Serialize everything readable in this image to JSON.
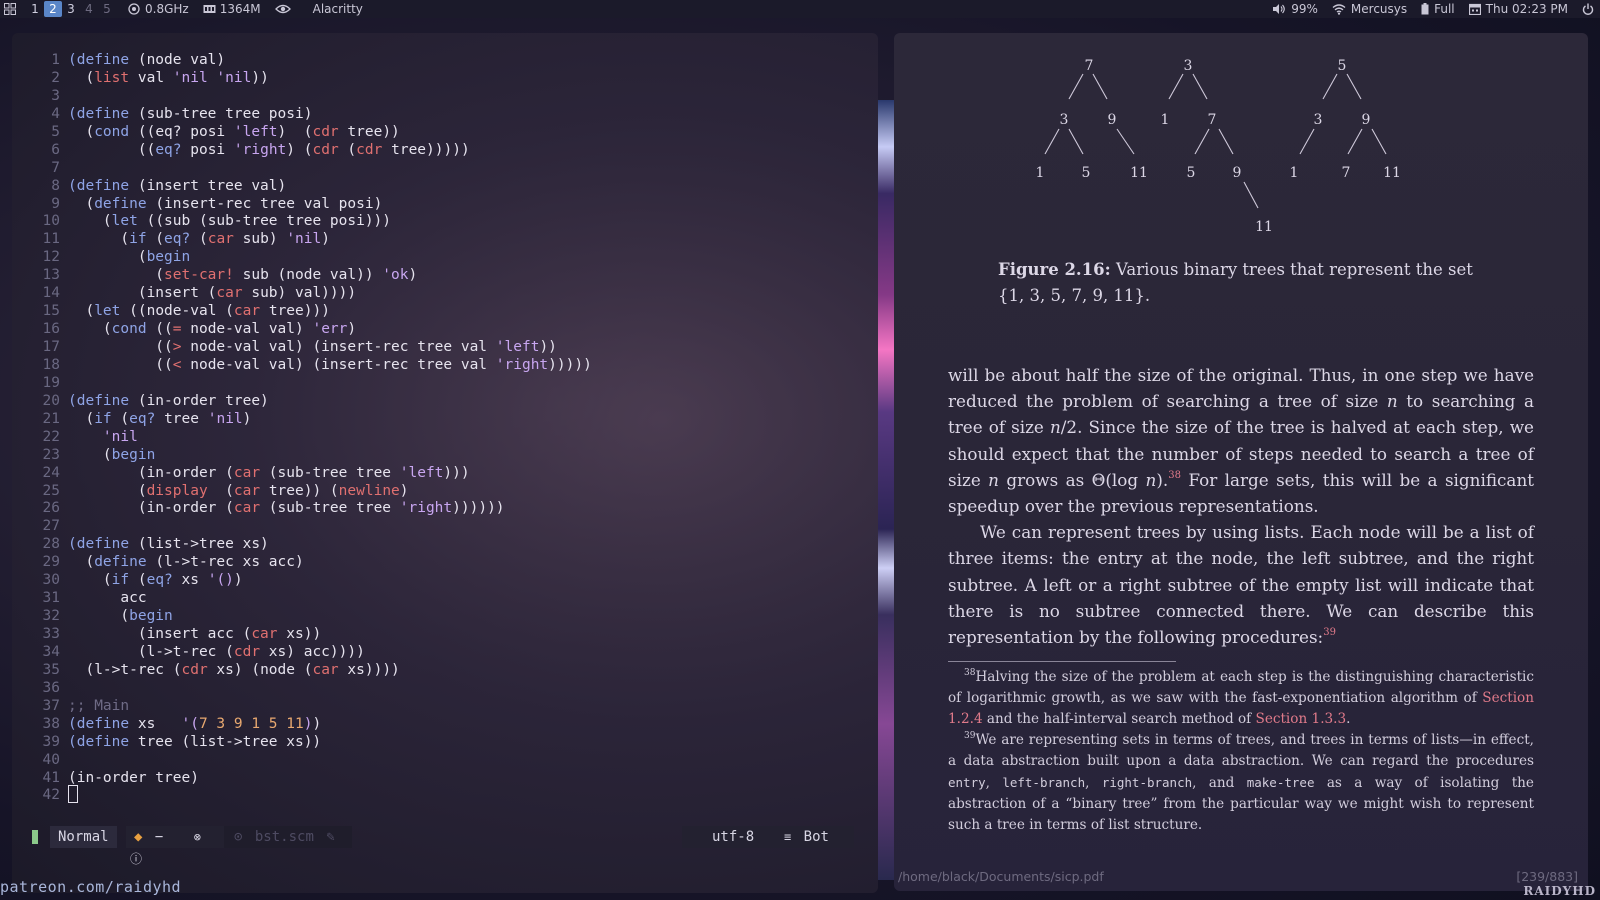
{
  "topbar": {
    "workspaces": [
      "1",
      "2",
      "3",
      "4",
      "5"
    ],
    "active_workspace": "2",
    "cpu": "0.8GHz",
    "memory": "1364M",
    "window_title": "Alacritty",
    "volume": "99%",
    "wifi": "Mercusys",
    "battery": "Full",
    "clock": "Thu 02:23 PM"
  },
  "editor": {
    "lines": [
      {
        "n": "1",
        "t": [
          [
            "kw",
            "(define"
          ],
          [
            "p",
            " (node val)"
          ]
        ]
      },
      {
        "n": "2",
        "t": [
          [
            "p",
            "  ("
          ],
          [
            "fn",
            "list"
          ],
          [
            "p",
            " val "
          ],
          [
            "sym",
            "'nil 'nil"
          ],
          [
            "p",
            "))"
          ]
        ]
      },
      {
        "n": "3",
        "t": []
      },
      {
        "n": "4",
        "t": [
          [
            "kw",
            "(define"
          ],
          [
            "p",
            " (sub-tree tree posi)"
          ]
        ]
      },
      {
        "n": "5",
        "t": [
          [
            "p",
            "  ("
          ],
          [
            "kw",
            "cond"
          ],
          [
            "p",
            " ((eq? posi "
          ],
          [
            "sym",
            "'left"
          ],
          [
            "p",
            ")  ("
          ],
          [
            "fn",
            "cdr"
          ],
          [
            "p",
            " tree))"
          ]
        ]
      },
      {
        "n": "6",
        "t": [
          [
            "p",
            "        (("
          ],
          [
            "kw",
            "eq?"
          ],
          [
            "p",
            " posi "
          ],
          [
            "sym",
            "'right"
          ],
          [
            "p",
            ") ("
          ],
          [
            "fn",
            "cdr"
          ],
          [
            "p",
            " ("
          ],
          [
            "fn",
            "cdr"
          ],
          [
            "p",
            " tree)))))"
          ]
        ]
      },
      {
        "n": "7",
        "t": []
      },
      {
        "n": "8",
        "t": [
          [
            "kw",
            "(define"
          ],
          [
            "p",
            " (insert tree val)"
          ]
        ]
      },
      {
        "n": "9",
        "t": [
          [
            "p",
            "  ("
          ],
          [
            "kw",
            "define"
          ],
          [
            "p",
            " (insert-rec tree val posi)"
          ]
        ]
      },
      {
        "n": "10",
        "t": [
          [
            "p",
            "    ("
          ],
          [
            "kw",
            "let"
          ],
          [
            "p",
            " ((sub (sub-tree tree posi)))"
          ]
        ]
      },
      {
        "n": "11",
        "t": [
          [
            "p",
            "      ("
          ],
          [
            "kw",
            "if"
          ],
          [
            "p",
            " ("
          ],
          [
            "kw",
            "eq?"
          ],
          [
            "p",
            " ("
          ],
          [
            "fn",
            "car"
          ],
          [
            "p",
            " sub) "
          ],
          [
            "sym",
            "'nil"
          ],
          [
            "p",
            ")"
          ]
        ]
      },
      {
        "n": "12",
        "t": [
          [
            "p",
            "        ("
          ],
          [
            "kw",
            "begin"
          ]
        ]
      },
      {
        "n": "13",
        "t": [
          [
            "p",
            "          ("
          ],
          [
            "fn",
            "set-car!"
          ],
          [
            "p",
            " sub (node val)) "
          ],
          [
            "sym",
            "'ok"
          ],
          [
            "p",
            ")"
          ]
        ]
      },
      {
        "n": "14",
        "t": [
          [
            "p",
            "        (insert ("
          ],
          [
            "fn",
            "car"
          ],
          [
            "p",
            " sub) val))))"
          ]
        ]
      },
      {
        "n": "15",
        "t": [
          [
            "p",
            "  ("
          ],
          [
            "kw",
            "let"
          ],
          [
            "p",
            " ((node-val ("
          ],
          [
            "fn",
            "car"
          ],
          [
            "p",
            " tree)))"
          ]
        ]
      },
      {
        "n": "16",
        "t": [
          [
            "p",
            "    ("
          ],
          [
            "kw",
            "cond"
          ],
          [
            "p",
            " (("
          ],
          [
            "fn",
            "="
          ],
          [
            "p",
            " node-val val) "
          ],
          [
            "sym",
            "'err"
          ],
          [
            "p",
            ")"
          ]
        ]
      },
      {
        "n": "17",
        "t": [
          [
            "p",
            "          (("
          ],
          [
            "fn",
            ">"
          ],
          [
            "p",
            " node-val val) (insert-rec tree val "
          ],
          [
            "sym",
            "'left"
          ],
          [
            "p",
            "))"
          ]
        ]
      },
      {
        "n": "18",
        "t": [
          [
            "p",
            "          (("
          ],
          [
            "fn",
            "<"
          ],
          [
            "p",
            " node-val val) (insert-rec tree val "
          ],
          [
            "sym",
            "'right"
          ],
          [
            "p",
            ")))))"
          ]
        ]
      },
      {
        "n": "19",
        "t": []
      },
      {
        "n": "20",
        "t": [
          [
            "kw",
            "(define"
          ],
          [
            "p",
            " (in-order tree)"
          ]
        ]
      },
      {
        "n": "21",
        "t": [
          [
            "p",
            "  ("
          ],
          [
            "kw",
            "if"
          ],
          [
            "p",
            " ("
          ],
          [
            "kw",
            "eq?"
          ],
          [
            "p",
            " tree "
          ],
          [
            "sym",
            "'nil"
          ],
          [
            "p",
            ")"
          ]
        ]
      },
      {
        "n": "22",
        "t": [
          [
            "p",
            "    "
          ],
          [
            "sym",
            "'nil"
          ]
        ]
      },
      {
        "n": "23",
        "t": [
          [
            "p",
            "    ("
          ],
          [
            "kw",
            "begin"
          ]
        ]
      },
      {
        "n": "24",
        "t": [
          [
            "p",
            "        (in-order ("
          ],
          [
            "fn",
            "car"
          ],
          [
            "p",
            " (sub-tree tree "
          ],
          [
            "sym",
            "'left"
          ],
          [
            "p",
            ")))"
          ]
        ]
      },
      {
        "n": "25",
        "t": [
          [
            "p",
            "        ("
          ],
          [
            "fn",
            "display"
          ],
          [
            "p",
            "  ("
          ],
          [
            "fn",
            "car"
          ],
          [
            "p",
            " tree)) ("
          ],
          [
            "fn",
            "newline"
          ],
          [
            "p",
            ")"
          ]
        ]
      },
      {
        "n": "26",
        "t": [
          [
            "p",
            "        (in-order ("
          ],
          [
            "fn",
            "car"
          ],
          [
            "p",
            " (sub-tree tree "
          ],
          [
            "sym",
            "'right"
          ],
          [
            "p",
            "))))))"
          ]
        ]
      },
      {
        "n": "27",
        "t": []
      },
      {
        "n": "28",
        "t": [
          [
            "kw",
            "(define"
          ],
          [
            "p",
            " (list->tree xs)"
          ]
        ]
      },
      {
        "n": "29",
        "t": [
          [
            "p",
            "  ("
          ],
          [
            "kw",
            "define"
          ],
          [
            "p",
            " (l->t-rec xs acc)"
          ]
        ]
      },
      {
        "n": "30",
        "t": [
          [
            "p",
            "    ("
          ],
          [
            "kw",
            "if"
          ],
          [
            "p",
            " ("
          ],
          [
            "kw",
            "eq?"
          ],
          [
            "p",
            " xs "
          ],
          [
            "sym",
            "'()"
          ],
          [
            "p",
            ")"
          ]
        ]
      },
      {
        "n": "31",
        "t": [
          [
            "p",
            "      acc"
          ]
        ]
      },
      {
        "n": "32",
        "t": [
          [
            "p",
            "      ("
          ],
          [
            "kw",
            "begin"
          ]
        ]
      },
      {
        "n": "33",
        "t": [
          [
            "p",
            "        (insert acc ("
          ],
          [
            "fn",
            "car"
          ],
          [
            "p",
            " xs))"
          ]
        ]
      },
      {
        "n": "34",
        "t": [
          [
            "p",
            "        (l->t-rec ("
          ],
          [
            "fn",
            "cdr"
          ],
          [
            "p",
            " xs) acc))))"
          ]
        ]
      },
      {
        "n": "35",
        "t": [
          [
            "p",
            "  (l->t-rec ("
          ],
          [
            "fn",
            "cdr"
          ],
          [
            "p",
            " xs) (node ("
          ],
          [
            "fn",
            "car"
          ],
          [
            "p",
            " xs))))"
          ]
        ]
      },
      {
        "n": "36",
        "t": []
      },
      {
        "n": "37",
        "t": [
          [
            "cm",
            ";; Main"
          ]
        ]
      },
      {
        "n": "38",
        "t": [
          [
            "kw",
            "(define"
          ],
          [
            "p",
            " xs   "
          ],
          [
            "sym",
            "'("
          ],
          [
            "num",
            "7 3 9 1 5 11"
          ],
          [
            "sym",
            ")"
          ],
          [
            "p",
            ")"
          ]
        ]
      },
      {
        "n": "39",
        "t": [
          [
            "kw",
            "(define"
          ],
          [
            "p",
            " tree (list->tree xs))"
          ]
        ]
      },
      {
        "n": "40",
        "t": []
      },
      {
        "n": "41",
        "t": [
          [
            "p",
            "(in-order tree)"
          ]
        ]
      },
      {
        "n": "42",
        "t": [
          [
            "cursor",
            ""
          ]
        ]
      }
    ],
    "tilde": "~",
    "status": {
      "mode": "Normal",
      "git": "−",
      "filename": "bst.scm",
      "encoding": "utf-8",
      "position": "Bot"
    }
  },
  "reader": {
    "tree_labels": {
      "t1": [
        "7",
        "3",
        "9",
        "1",
        "5",
        "11"
      ],
      "t2": [
        "3",
        "1",
        "7",
        "5",
        "9",
        "11"
      ],
      "t3": [
        "5",
        "3",
        "9",
        "1",
        "7",
        "11"
      ]
    },
    "caption_label": "Figure 2.16:",
    "caption_text": " Various binary trees that represent the set {1, 3, 5, 7, 9, 11}.",
    "para1_a": "will be about half the size of the original. Thus, in one step we have reduced the problem of searching a tree of size ",
    "para1_n1": "n",
    "para1_b": " to searching a tree of size ",
    "para1_n2": "n",
    "para1_c": "/2. Since the size of the tree is halved at each step, we should expect that the number of steps needed to search a tree of size ",
    "para1_n3": "n",
    "para1_d": " grows as Θ(log ",
    "para1_n4": "n",
    "para1_e": ").",
    "para1_sup": "38",
    "para1_f": " For large sets, this will be a significant speedup over the previous representations.",
    "para2": "We can represent trees by using lists. Each node will be a list of three items: the entry at the node, the left subtree, and the right subtree. A left or a right subtree of the empty list will indicate that there is no subtree connected there. We can describe this representation by the following procedures:",
    "para2_sup": "39",
    "fn38_num": "38",
    "fn38_a": "Halving the size of the problem at each step is the distinguishing characteristic of logarithmic growth, as we saw with the fast-exponentiation algorithm of ",
    "fn38_link1": "Section 1.2.4",
    "fn38_b": " and the half-interval search method of ",
    "fn38_link2": "Section 1.3.3",
    "fn38_c": ".",
    "fn39_num": "39",
    "fn39_a": "We are representing sets in terms of trees, and trees in terms of lists—in effect, a data abstraction built upon a data abstraction. We can regard the procedures ",
    "fn39_code1": "entry",
    "fn39_b": ", ",
    "fn39_code2": "left-branch",
    "fn39_c": ", ",
    "fn39_code3": "right-branch",
    "fn39_d": ", and ",
    "fn39_code4": "make-tree",
    "fn39_e": " as a way of isolating the abstraction of a “binary tree” from the particular way we might wish to represent such a tree in terms of list structure.",
    "path": "/home/black/Documents/sicp.pdf",
    "page": "[239/883]"
  },
  "watermark_left": "patreon.com/raidyhd",
  "watermark_right": "RAIDYHD",
  "colors": {
    "keyword": "#8fa4e6",
    "builtin": "#e07070",
    "symbol": "#c8a6f0",
    "number": "#e8a870",
    "link": "#e07a8a",
    "active_workspace": "#5a86c8"
  }
}
